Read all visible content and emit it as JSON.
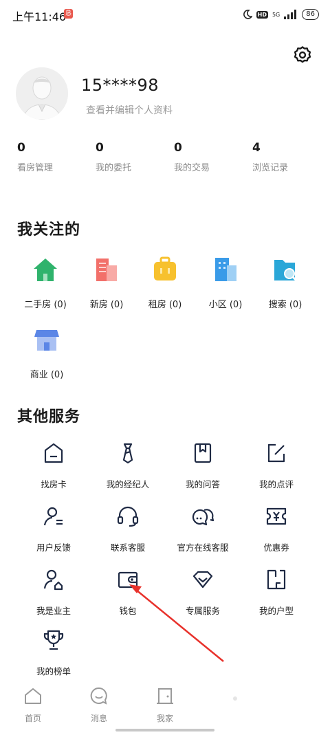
{
  "status_bar": {
    "time": "上午11:46",
    "notification_glyph": "恳",
    "hd": "HD",
    "network": "5G",
    "battery": "86"
  },
  "profile": {
    "username": "15****98",
    "edit_hint": "查看并编辑个人资料"
  },
  "stats": [
    {
      "value": "0",
      "label": "看房管理"
    },
    {
      "value": "0",
      "label": "我的委托"
    },
    {
      "value": "0",
      "label": "我的交易"
    },
    {
      "value": "4",
      "label": "浏览记录"
    }
  ],
  "follow_section": {
    "title": "我关注的",
    "items": [
      {
        "label": "二手房 (0)",
        "icon": "house-icon",
        "color": "#2fb36c"
      },
      {
        "label": "新房 (0)",
        "icon": "new-building-icon",
        "color": "#f2706a"
      },
      {
        "label": "租房 (0)",
        "icon": "suitcase-icon",
        "color": "#f7c12e"
      },
      {
        "label": "小区 (0)",
        "icon": "community-icon",
        "color": "#3a9be8"
      },
      {
        "label": "搜索 (0)",
        "icon": "search-folder-icon",
        "color": "#2aa7d8"
      },
      {
        "label": "商业 (0)",
        "icon": "shop-icon",
        "color": "#5b86e6"
      }
    ]
  },
  "services_section": {
    "title": "其他服务",
    "items": [
      {
        "label": "找房卡",
        "icon": "card-icon"
      },
      {
        "label": "我的经纪人",
        "icon": "tie-icon"
      },
      {
        "label": "我的问答",
        "icon": "book-icon"
      },
      {
        "label": "我的点评",
        "icon": "edit-icon"
      },
      {
        "label": "用户反馈",
        "icon": "feedback-user-icon"
      },
      {
        "label": "联系客服",
        "icon": "headset-icon"
      },
      {
        "label": "官方在线客服",
        "icon": "chat-bubbles-icon"
      },
      {
        "label": "优惠券",
        "icon": "coupon-icon"
      },
      {
        "label": "我是业主",
        "icon": "owner-icon"
      },
      {
        "label": "钱包",
        "icon": "wallet-icon"
      },
      {
        "label": "专属服务",
        "icon": "diamond-icon"
      },
      {
        "label": "我的户型",
        "icon": "floorplan-icon"
      },
      {
        "label": "我的榜单",
        "icon": "trophy-icon"
      }
    ]
  },
  "tab_bar": [
    {
      "label": "首页",
      "icon": "home-tab-icon"
    },
    {
      "label": "消息",
      "icon": "message-tab-icon"
    },
    {
      "label": "我家",
      "icon": "my-home-tab-icon"
    },
    {
      "label": "",
      "icon": "profile-tab-icon"
    }
  ],
  "colors": {
    "annotation_arrow": "#e8312b",
    "icon_stroke": "#1f2a44"
  }
}
